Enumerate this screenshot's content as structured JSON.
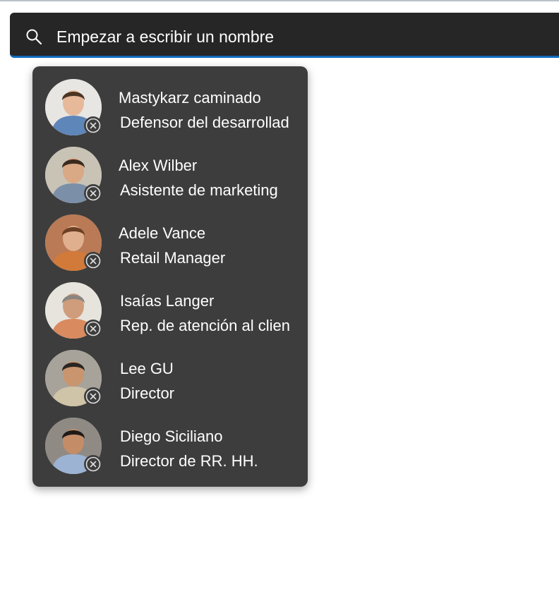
{
  "search": {
    "placeholder": "Empezar a escribir un nombre",
    "icon": "search-icon"
  },
  "people": [
    {
      "name": "Mastykarz caminado",
      "role": "Defensor del desarrollad",
      "bg": "#e8e6e2",
      "shirt": "#5f86b8",
      "skin": "#e6b99a",
      "hair": "#4b3524"
    },
    {
      "name": "Alex Wilber",
      "role": "Asistente de marketing",
      "bg": "#c9c3b6",
      "shirt": "#7b8fa8",
      "skin": "#d9a885",
      "hair": "#3a2a1e"
    },
    {
      "name": "Adele Vance",
      "role": "Retail Manager",
      "bg": "#b97a55",
      "shirt": "#d27a3a",
      "skin": "#e0b08e",
      "hair": "#6a3f24"
    },
    {
      "name": "Isaías Langer",
      "role": "Rep. de atención al clien",
      "bg": "#e7e4de",
      "shirt": "#d98a5e",
      "skin": "#cf9d7c",
      "hair": "#8a8580"
    },
    {
      "name": "Lee GU",
      "role": "Director",
      "bg": "#a7a39a",
      "shirt": "#cfc3a8",
      "skin": "#c9956f",
      "hair": "#2b2622"
    },
    {
      "name": "Diego Siciliano",
      "role": "Director de RR. HH.",
      "bg": "#8f8a84",
      "shirt": "#9db3d4",
      "skin": "#c48d68",
      "hair": "#1f1a17"
    }
  ],
  "remove_icon": "remove-circle-icon",
  "colors": {
    "search_bg": "#262626",
    "accent": "#0f6cbd",
    "dropdown_bg": "#3d3d3d"
  }
}
